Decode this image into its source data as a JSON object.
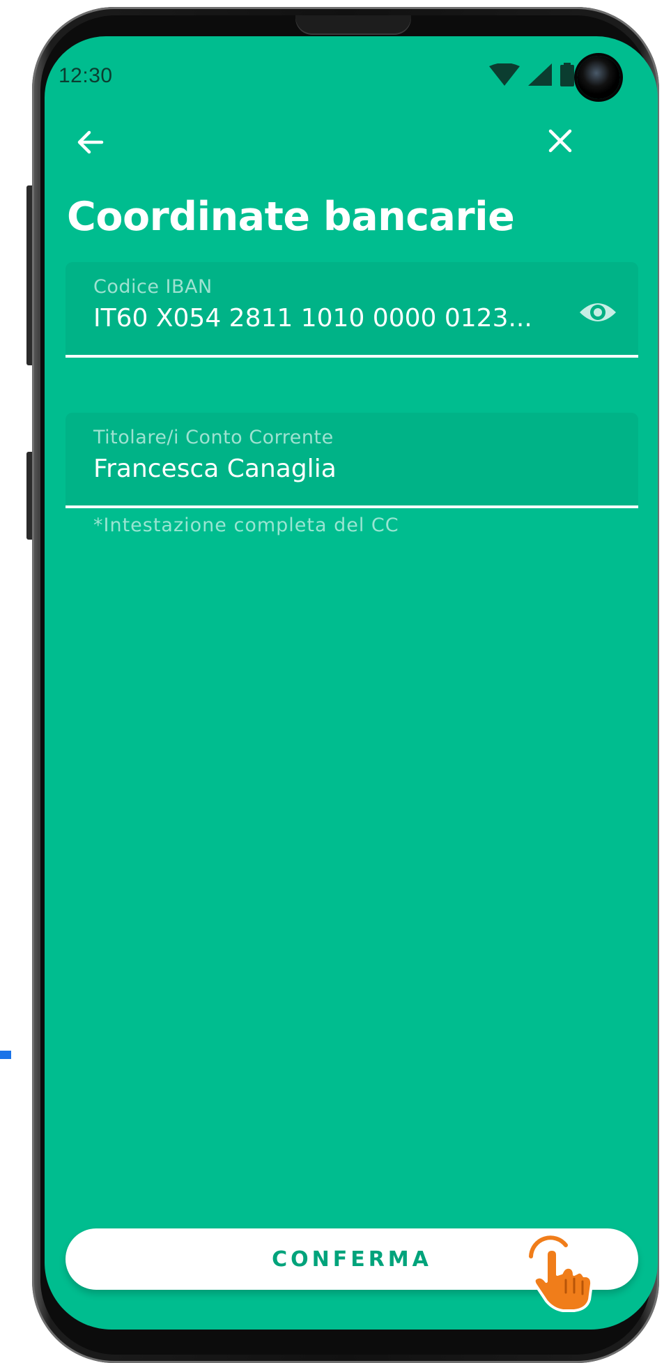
{
  "status_bar": {
    "time": "12:30"
  },
  "header": {
    "title": "Coordinate bancarie",
    "back_icon": "arrow-left-icon",
    "close_icon": "close-icon"
  },
  "form": {
    "iban": {
      "label": "Codice IBAN",
      "value": "IT60 X054 2811 1010 0000 0123...",
      "toggle_icon": "eye-icon"
    },
    "holder": {
      "label": "Titolare/i Conto Corrente",
      "value": "Francesca Canaglia",
      "helper": "*Intestazione completa del CC"
    }
  },
  "actions": {
    "confirm_label": "CONFERMA"
  },
  "colors": {
    "screen_background": "#00bd8f",
    "button_text": "#00a37b",
    "cursor_hand": "#f07d1a",
    "marker": "#1a73e8"
  }
}
